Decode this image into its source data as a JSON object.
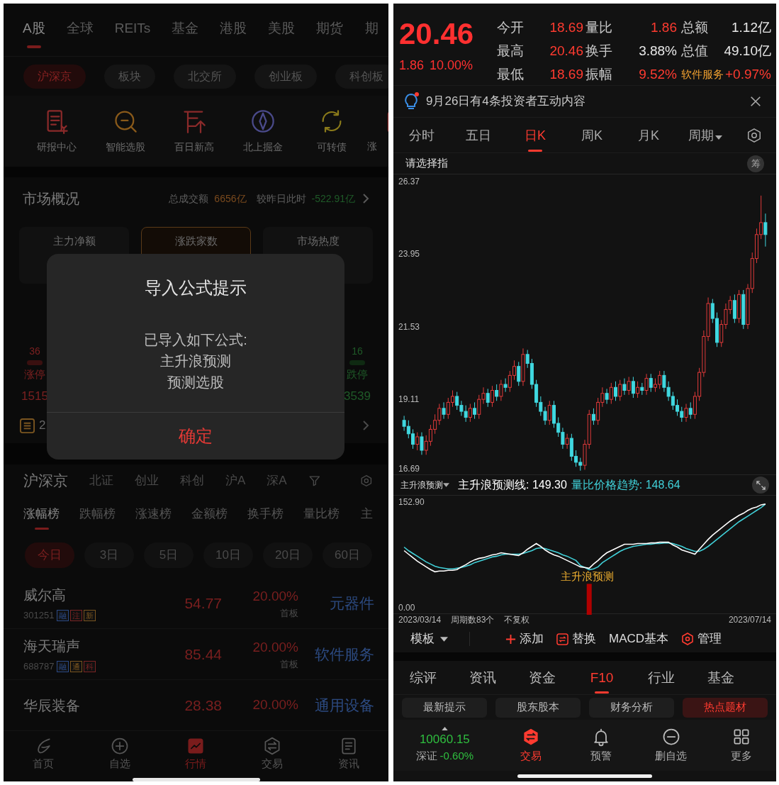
{
  "left": {
    "market_tabs": [
      {
        "label": "A股",
        "selected": true
      },
      {
        "label": "全球",
        "selected": false
      },
      {
        "label": "REITs",
        "selected": false
      },
      {
        "label": "基金",
        "selected": false
      },
      {
        "label": "港股",
        "selected": false
      },
      {
        "label": "美股",
        "selected": false
      },
      {
        "label": "期货",
        "selected": false
      },
      {
        "label": "期",
        "selected": false
      }
    ],
    "board_chips": [
      {
        "label": "沪深京",
        "selected": true
      },
      {
        "label": "板块",
        "selected": false
      },
      {
        "label": "北交所",
        "selected": false
      },
      {
        "label": "创业板",
        "selected": false
      },
      {
        "label": "科创板",
        "selected": false
      }
    ],
    "shortcuts": [
      {
        "label": "研报中心",
        "kind": "report",
        "color": "#8a2a2a"
      },
      {
        "label": "智能选股",
        "kind": "magnifier",
        "color": "#8a5a1a"
      },
      {
        "label": "百日新高",
        "kind": "arrow-up",
        "color": "#8a2a2a"
      },
      {
        "label": "北上掘金",
        "kind": "compass",
        "color": "#4a4a8a"
      },
      {
        "label": "可转债",
        "kind": "cycle",
        "color": "#8a7a1a"
      },
      {
        "label": "涨",
        "kind": "cut",
        "color": "#8a2a2a"
      }
    ],
    "market_overview": {
      "title": "市场概况",
      "turnover_label": "总成交额",
      "turnover": "6656亿",
      "compare_label": "较昨日此时",
      "compare": "-522.91亿"
    },
    "cards": [
      {
        "title": "主力净额",
        "selected": false
      },
      {
        "title": "涨跌家数",
        "selected": true
      },
      {
        "title": "市场热度",
        "selected": false
      }
    ],
    "limit_up": {
      "count": "36",
      "label": "涨停",
      "total": "1515"
    },
    "limit_down": {
      "count": "16",
      "label": "跌停",
      "total": "3539"
    },
    "news_row": {
      "text": "2"
    },
    "dialog": {
      "title": "导入公式提示",
      "lines": [
        "已导入如下公式:",
        "主升浪预测",
        "预测选股"
      ],
      "confirm": "确定"
    },
    "exchange_tabs": [
      {
        "label": "沪深京",
        "selected": true
      },
      {
        "label": "北证",
        "selected": false
      },
      {
        "label": "创业",
        "selected": false
      },
      {
        "label": "科创",
        "selected": false
      },
      {
        "label": "沪A",
        "selected": false
      },
      {
        "label": "深A",
        "selected": false
      }
    ],
    "rank_tabs": [
      {
        "label": "涨幅榜",
        "selected": true
      },
      {
        "label": "跌幅榜",
        "selected": false
      },
      {
        "label": "涨速榜",
        "selected": false
      },
      {
        "label": "金额榜",
        "selected": false
      },
      {
        "label": "换手榜",
        "selected": false
      },
      {
        "label": "量比榜",
        "selected": false
      },
      {
        "label": "主",
        "selected": false
      }
    ],
    "period_chips": [
      {
        "label": "今日",
        "selected": true
      },
      {
        "label": "3日",
        "selected": false
      },
      {
        "label": "5日",
        "selected": false
      },
      {
        "label": "10日",
        "selected": false
      },
      {
        "label": "20日",
        "selected": false
      },
      {
        "label": "60日",
        "selected": false
      }
    ],
    "stocks": [
      {
        "name": "威尔高",
        "code": "301251",
        "tags": [
          {
            "label": "融",
            "color": "#2b4a86"
          },
          {
            "label": "注",
            "color": "#7a2424"
          },
          {
            "label": "新",
            "color": "#7a5520"
          }
        ],
        "price": "54.77",
        "change": "20.00%",
        "note": "首板",
        "sector": "元器件"
      },
      {
        "name": "海天瑞声",
        "code": "688787",
        "tags": [
          {
            "label": "融",
            "color": "#2b4a86"
          },
          {
            "label": "通",
            "color": "#7a5520"
          },
          {
            "label": "科",
            "color": "#7a2424"
          }
        ],
        "price": "85.44",
        "change": "20.00%",
        "note": "首板",
        "sector": "软件服务"
      },
      {
        "name": "华辰装备",
        "price": "28.38",
        "change": "20.00%",
        "sector": "通用设备"
      }
    ],
    "bottom_nav": [
      {
        "label": "首页",
        "kind": "swoosh",
        "selected": false
      },
      {
        "label": "自选",
        "kind": "plus-circle",
        "selected": false
      },
      {
        "label": "行情",
        "kind": "chart",
        "selected": true
      },
      {
        "label": "交易",
        "kind": "hex-swap",
        "selected": false
      },
      {
        "label": "资讯",
        "kind": "doc",
        "selected": false
      }
    ]
  },
  "right": {
    "quote": {
      "price": "20.46",
      "change": "1.86",
      "percent": "10.00%"
    },
    "stats": [
      {
        "label": "今开",
        "value": "18.69",
        "color": "#ff3b30",
        "kind": "stat"
      },
      {
        "label": "量比",
        "value": "1.86",
        "color": "#ff3b30",
        "kind": "stat"
      },
      {
        "label": "总额",
        "value": "1.12亿",
        "color": "#e8e8e8",
        "kind": "stat"
      },
      {
        "label": "最高",
        "value": "20.46",
        "color": "#ff3b30",
        "kind": "stat"
      },
      {
        "label": "换手",
        "value": "3.88%",
        "color": "#e8e8e8",
        "kind": "stat"
      },
      {
        "label": "总值",
        "value": "49.10亿",
        "color": "#e8e8e8",
        "kind": "stat"
      },
      {
        "label": "最低",
        "value": "18.69",
        "color": "#ff3b30",
        "kind": "stat"
      },
      {
        "label": "振幅",
        "value": "9.52%",
        "color": "#ff3b30",
        "kind": "stat"
      },
      {
        "label": "软件服务",
        "value": "+0.97%",
        "color": "#ff3b30",
        "kind": "sector"
      }
    ],
    "notice": {
      "text": "9月26日有4条投资者互动内容",
      "unread": true
    },
    "chart_tabs": [
      {
        "label": "分时",
        "selected": false,
        "kind": "tab"
      },
      {
        "label": "五日",
        "selected": false,
        "kind": "tab"
      },
      {
        "label": "日K",
        "selected": true,
        "kind": "tab"
      },
      {
        "label": "周K",
        "selected": false,
        "kind": "tab"
      },
      {
        "label": "月K",
        "selected": false,
        "kind": "tab"
      },
      {
        "label": "周期",
        "selected": false,
        "kind": "dropdown"
      }
    ],
    "indicator_prompt": "请选择指",
    "chip_button": "筹",
    "kline": {
      "chart_data": {
        "type": "candlestick",
        "ohlc": [
          [
            18.4,
            18.55,
            18.05,
            18.2
          ],
          [
            18.2,
            18.4,
            17.8,
            17.95
          ],
          [
            17.95,
            18.1,
            17.45,
            17.6
          ],
          [
            17.6,
            18.0,
            17.4,
            17.85
          ],
          [
            17.85,
            18.0,
            17.25,
            17.4
          ],
          [
            17.4,
            17.9,
            17.25,
            17.7
          ],
          [
            17.7,
            18.25,
            17.55,
            18.1
          ],
          [
            18.1,
            18.6,
            17.95,
            18.4
          ],
          [
            18.4,
            18.95,
            18.25,
            18.8
          ],
          [
            18.8,
            19.0,
            18.45,
            18.6
          ],
          [
            18.6,
            19.15,
            18.45,
            19.0
          ],
          [
            19.0,
            19.4,
            18.85,
            19.2
          ],
          [
            19.2,
            19.35,
            18.75,
            18.9
          ],
          [
            18.9,
            19.05,
            18.55,
            18.7
          ],
          [
            18.7,
            18.9,
            18.35,
            18.5
          ],
          [
            18.5,
            18.95,
            18.35,
            18.8
          ],
          [
            18.8,
            19.0,
            18.45,
            18.6
          ],
          [
            18.6,
            19.25,
            18.45,
            19.1
          ],
          [
            19.1,
            19.5,
            18.95,
            19.3
          ],
          [
            19.3,
            19.45,
            18.85,
            19.0
          ],
          [
            19.0,
            19.55,
            18.85,
            19.4
          ],
          [
            19.4,
            19.6,
            19.05,
            19.2
          ],
          [
            19.2,
            19.75,
            19.05,
            19.6
          ],
          [
            19.6,
            19.8,
            19.35,
            19.5
          ],
          [
            19.5,
            20.05,
            19.35,
            19.9
          ],
          [
            19.9,
            20.4,
            19.75,
            20.2
          ],
          [
            20.2,
            20.35,
            19.55,
            19.7
          ],
          [
            19.7,
            20.8,
            19.55,
            20.6
          ],
          [
            20.6,
            20.75,
            20.15,
            20.3
          ],
          [
            20.3,
            20.45,
            19.45,
            19.6
          ],
          [
            19.6,
            19.75,
            18.85,
            19.0
          ],
          [
            19.0,
            19.2,
            18.55,
            18.7
          ],
          [
            18.7,
            18.85,
            18.25,
            18.4
          ],
          [
            18.4,
            19.05,
            18.25,
            18.9
          ],
          [
            18.9,
            19.05,
            18.15,
            18.3
          ],
          [
            18.3,
            18.5,
            17.85,
            18.0
          ],
          [
            18.0,
            18.15,
            17.45,
            17.6
          ],
          [
            17.6,
            17.95,
            17.45,
            17.8
          ],
          [
            17.8,
            17.95,
            17.05,
            17.2
          ],
          [
            17.2,
            17.4,
            16.85,
            17.0
          ],
          [
            17.0,
            17.15,
            16.72,
            16.9
          ],
          [
            16.9,
            17.75,
            16.75,
            17.6
          ],
          [
            17.6,
            18.75,
            17.45,
            18.6
          ],
          [
            18.6,
            18.8,
            18.25,
            18.4
          ],
          [
            18.4,
            19.15,
            18.25,
            19.0
          ],
          [
            19.0,
            19.5,
            18.85,
            19.3
          ],
          [
            19.3,
            19.45,
            18.95,
            19.1
          ],
          [
            19.1,
            19.65,
            18.95,
            19.5
          ],
          [
            19.5,
            19.7,
            19.05,
            19.2
          ],
          [
            19.2,
            19.75,
            19.05,
            19.6
          ],
          [
            19.6,
            19.8,
            19.25,
            19.4
          ],
          [
            19.4,
            19.85,
            19.25,
            19.7
          ],
          [
            19.7,
            19.85,
            19.15,
            19.3
          ],
          [
            19.3,
            19.7,
            19.15,
            19.5
          ],
          [
            19.5,
            19.65,
            19.25,
            19.4
          ],
          [
            19.4,
            19.95,
            19.25,
            19.8
          ],
          [
            19.8,
            19.95,
            19.35,
            19.5
          ],
          [
            19.5,
            19.8,
            19.35,
            19.6
          ],
          [
            19.6,
            20.05,
            19.45,
            19.9
          ],
          [
            19.9,
            20.05,
            19.35,
            19.5
          ],
          [
            19.5,
            19.7,
            19.05,
            19.2
          ],
          [
            19.2,
            19.35,
            18.75,
            18.9
          ],
          [
            18.9,
            19.1,
            18.55,
            18.7
          ],
          [
            18.7,
            18.85,
            18.35,
            18.5
          ],
          [
            18.5,
            18.95,
            18.35,
            18.8
          ],
          [
            18.8,
            19.0,
            18.45,
            18.6
          ],
          [
            18.6,
            19.35,
            18.45,
            19.2
          ],
          [
            19.2,
            20.15,
            19.05,
            20.0
          ],
          [
            20.0,
            21.4,
            19.85,
            21.2
          ],
          [
            21.2,
            22.5,
            21.05,
            22.3
          ],
          [
            22.3,
            22.45,
            21.65,
            21.8
          ],
          [
            21.8,
            22.0,
            20.85,
            21.0
          ],
          [
            21.0,
            21.75,
            20.85,
            21.6
          ],
          [
            21.6,
            22.3,
            21.45,
            22.1
          ],
          [
            22.1,
            22.55,
            21.95,
            22.4
          ],
          [
            22.4,
            22.6,
            21.65,
            21.8
          ],
          [
            21.8,
            22.75,
            21.65,
            22.6
          ],
          [
            22.6,
            22.75,
            21.45,
            21.6
          ],
          [
            21.6,
            22.95,
            21.45,
            22.8
          ],
          [
            22.8,
            24.0,
            22.65,
            23.8
          ],
          [
            23.8,
            24.8,
            23.65,
            24.6
          ],
          [
            24.6,
            25.9,
            24.45,
            25.0
          ],
          [
            25.0,
            25.3,
            24.2,
            24.6
          ]
        ],
        "ylim": [
          16.69,
          26.37
        ],
        "yticks": [
          26.37,
          23.95,
          21.53,
          19.11,
          16.69
        ]
      }
    },
    "sub_chart": {
      "selector": "主升浪预测",
      "readings": [
        {
          "value": "149.30"
        },
        {
          "value": "148.64"
        }
      ],
      "chart_data": {
        "type": "line",
        "series": [
          {
            "name": "主升浪预测线:",
            "color": "#ffffff",
            "values": [
              83,
              78,
              73,
              68,
              64,
              60,
              56,
              53,
              54,
              54,
              55,
              55,
              56,
              60,
              63,
              67,
              70,
              72,
              73,
              75,
              77,
              78,
              80,
              79,
              78,
              77,
              76,
              80,
              85,
              89,
              93,
              89,
              84,
              80,
              77,
              75,
              72,
              69,
              66,
              63,
              60,
              59,
              58,
              64,
              69,
              75,
              80,
              83,
              86,
              89,
              92,
              92,
              92,
              93,
              93,
              93,
              94,
              94,
              95,
              95,
              95,
              91,
              88,
              84,
              82,
              80,
              78,
              85,
              92,
              99,
              105,
              110,
              115,
              120,
              125,
              129,
              133,
              136,
              140,
              143,
              145,
              148,
              149
            ]
          },
          {
            "name": "量比价格趋势:",
            "color": "#40d0d8",
            "values": [
              88,
              83,
              79,
              75,
              71,
              67,
              64,
              61,
              59,
              58,
              57,
              57,
              58,
              59,
              61,
              63,
              66,
              68,
              70,
              72,
              74,
              75,
              77,
              78,
              78,
              78,
              78,
              79,
              81,
              83,
              86,
              87,
              86,
              84,
              82,
              80,
              77,
              75,
              72,
              69,
              62,
              59,
              56,
              57,
              60,
              66,
              70,
              74,
              78,
              82,
              85,
              87,
              89,
              90,
              91,
              92,
              92,
              93,
              93,
              94,
              94,
              93,
              91,
              89,
              86,
              84,
              82,
              82,
              85,
              89,
              94,
              99,
              104,
              109,
              114,
              119,
              124,
              128,
              132,
              136,
              140,
              144,
              149
            ]
          }
        ],
        "ylim": [
          0,
          152.9
        ],
        "yticks": [
          {
            "value": 152.9,
            "label": "152.90"
          },
          {
            "value": 0,
            "label": "0.00"
          }
        ],
        "annotations": [
          "主升浪预测"
        ]
      },
      "start_date": "2023/03/14",
      "period_count": "周期数83个",
      "adjust": "不复权",
      "end_date": "2023/07/14"
    },
    "toolbar": [
      {
        "label": "模板",
        "kind": "dropdown"
      },
      {
        "label": "添加",
        "kind": "add"
      },
      {
        "label": "替换",
        "kind": "swap"
      },
      {
        "label": "MACD基本",
        "kind": "plain"
      },
      {
        "label": "管理",
        "kind": "manage"
      }
    ],
    "info_tabs": [
      {
        "label": "综评",
        "selected": false
      },
      {
        "label": "资讯",
        "selected": false
      },
      {
        "label": "资金",
        "selected": false
      },
      {
        "label": "F10",
        "selected": true
      },
      {
        "label": "行业",
        "selected": false
      },
      {
        "label": "基金",
        "selected": false
      }
    ],
    "f10_chips": [
      {
        "label": "最新提示",
        "selected": false
      },
      {
        "label": "股东股本",
        "selected": false
      },
      {
        "label": "财务分析",
        "selected": false
      },
      {
        "label": "热点题材",
        "selected": true
      }
    ],
    "index": {
      "value": "10060.15",
      "name": "深证",
      "change": "-0.60%"
    },
    "actions": [
      {
        "label": "交易",
        "kind": "hex-swap",
        "highlighted": true
      },
      {
        "label": "预警",
        "kind": "bell",
        "highlighted": false
      },
      {
        "label": "删自选",
        "kind": "minus-circle",
        "highlighted": false
      },
      {
        "label": "更多",
        "kind": "grid",
        "highlighted": false
      }
    ]
  }
}
